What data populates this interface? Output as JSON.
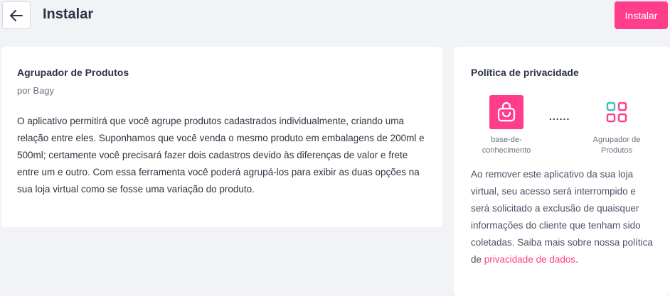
{
  "header": {
    "title": "Instalar",
    "install_label": "Instalar",
    "accent_color": "#ff3d8b"
  },
  "app": {
    "name": "Agrupador de Produtos",
    "author": "por Bagy",
    "description": "O aplicativo permitirá que você agrupe produtos cadastrados individualmente, criando uma relação entre eles. Suponhamos que você venda o mesmo produto em embalagens de 200ml e 500ml; certamente você precisará fazer dois cadastros devido às diferenças de valor e frete entre um e outro. Com essa ferramenta você poderá agrupá-los para exibir as duas opções na sua loja virtual como se fosse uma variação do produto."
  },
  "privacy": {
    "title": "Política de privacidade",
    "source_label": "base-de-conhecimento",
    "source_icon": "shopping-bag-icon",
    "connector": "......",
    "target_label": "Agrupador de Produtos",
    "target_icon": "grid-icon",
    "text_before": "Ao remover este aplicativo da sua loja virtual, seu acesso será interrompido e será solicitado a exclusão de quaisquer informações do cliente que tenham sido coletadas. Saiba mais sobre nossa política de ",
    "link_label": "privacidade de dados",
    "text_after": "."
  }
}
